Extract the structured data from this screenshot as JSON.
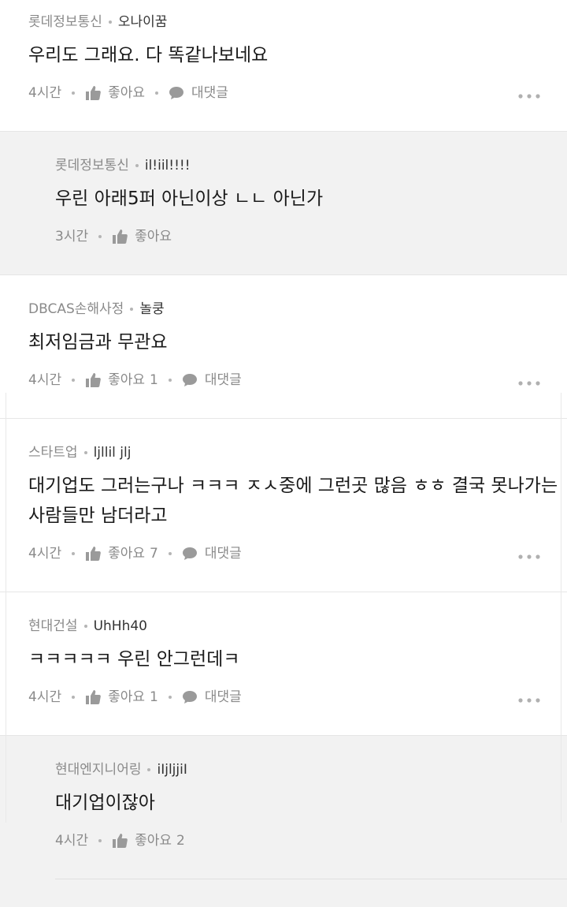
{
  "comments": [
    {
      "company": "롯데정보통신",
      "nick": "오나이꿈",
      "text": "우리도 그래요. 다 똑같나보네요",
      "time": "4시간",
      "like_label": "좋아요",
      "like_count": "",
      "reply_label": "대댓글"
    },
    {
      "company": "롯데정보통신",
      "nick": "il!iil!!!!",
      "text": "우린 아래5퍼 아닌이상 ㄴㄴ 아닌가",
      "time": "3시간",
      "like_label": "좋아요",
      "like_count": ""
    },
    {
      "company": "DBCAS손해사정",
      "nick": "놀쿵",
      "text": "최저임금과 무관요",
      "time": "4시간",
      "like_label": "좋아요",
      "like_count": "1",
      "reply_label": "대댓글"
    },
    {
      "company": "스타트업",
      "nick": "ljllil jlj",
      "text_line1": "대기업도 그러는구나 ㅋㅋㅋ ㅈㅅ중에 그런곳 많음 ㅎㅎ 결국 못나가는",
      "text_line2": "사람들만 남더라고",
      "time": "4시간",
      "like_label": "좋아요",
      "like_count": "7",
      "reply_label": "대댓글"
    },
    {
      "company": "현대건설",
      "nick": "UhHh40",
      "text": "ㅋㅋㅋㅋㅋ 우린 안그런데ㅋ",
      "time": "4시간",
      "like_label": "좋아요",
      "like_count": "1",
      "reply_label": "대댓글"
    },
    {
      "company": "현대엔지니어링",
      "nick": "iIjljjiI",
      "text": "대기업이잖아",
      "time": "4시간",
      "like_label": "좋아요",
      "like_count": "2"
    }
  ],
  "icons": {
    "like": "thumbs-up-icon",
    "reply": "speech-bubble-icon",
    "more": "more-dots-icon"
  },
  "colors": {
    "reply_background": "#f2f2f2",
    "meta_text": "#8a8a8a",
    "icon": "#9a9a9a"
  }
}
